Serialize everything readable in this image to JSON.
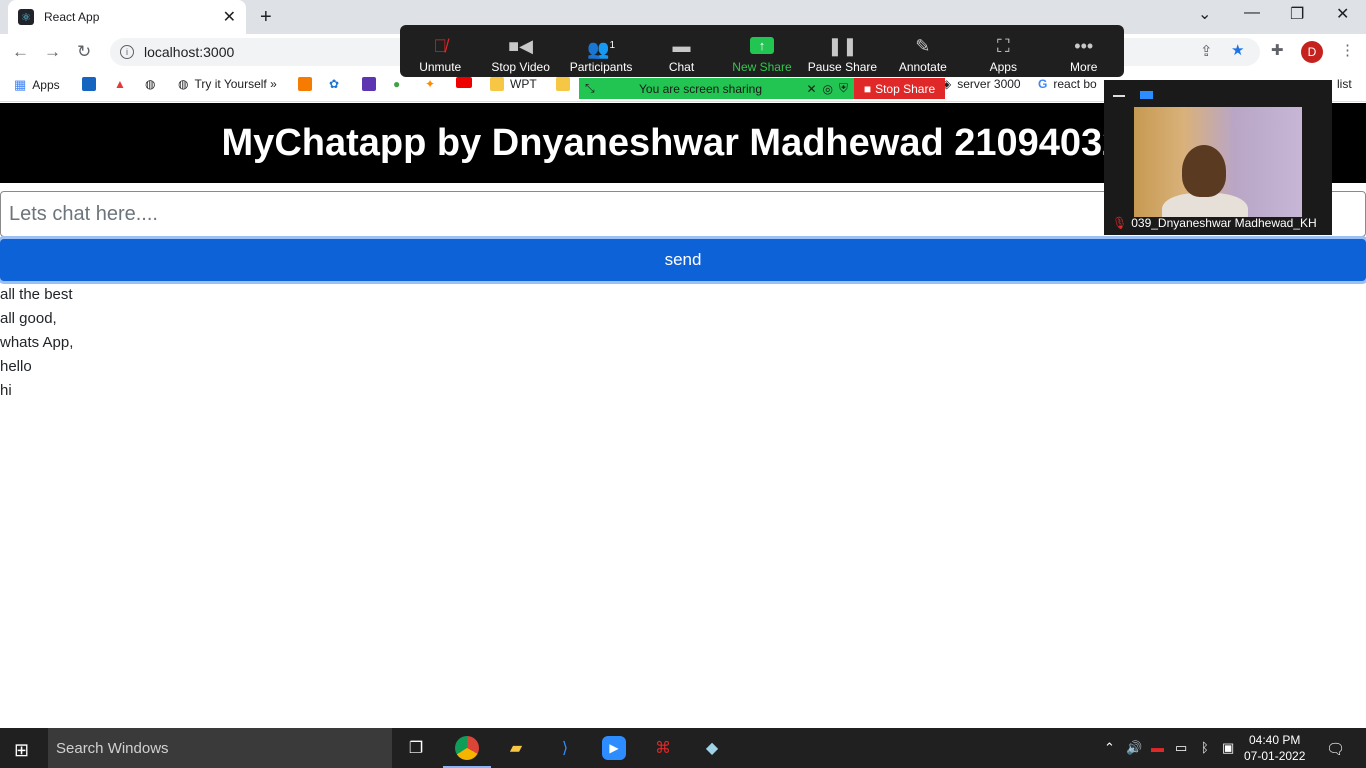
{
  "browser": {
    "tab_title": "React App",
    "url": "localhost:3000",
    "profile_initial": "D"
  },
  "bookmarks": {
    "apps": "Apps",
    "try_it": "Try it Yourself »",
    "wpt": "WPT",
    "server": "server 3000",
    "react": "react bo",
    "list": "list"
  },
  "zoom": {
    "buttons": {
      "unmute": "Unmute",
      "stop_video": "Stop Video",
      "participants": "Participants",
      "participants_count": "1",
      "chat": "Chat",
      "new_share": "New Share",
      "pause_share": "Pause Share",
      "annotate": "Annotate",
      "apps": "Apps",
      "more": "More"
    },
    "sharing_msg": "You are screen sharing",
    "stop_share": "Stop Share",
    "participant_name": "039_Dnyaneshwar Madhewad_KH"
  },
  "app": {
    "title": "MyChatapp by Dnyaneshwar Madhewad 210940320",
    "input_placeholder": "Lets chat here....",
    "send_label": "send",
    "messages": [
      "all the best",
      "all good,",
      "whats App,",
      "hello",
      "hi"
    ]
  },
  "taskbar": {
    "search_placeholder": "Search Windows",
    "time": "04:40 PM",
    "date": "07-01-2022"
  }
}
